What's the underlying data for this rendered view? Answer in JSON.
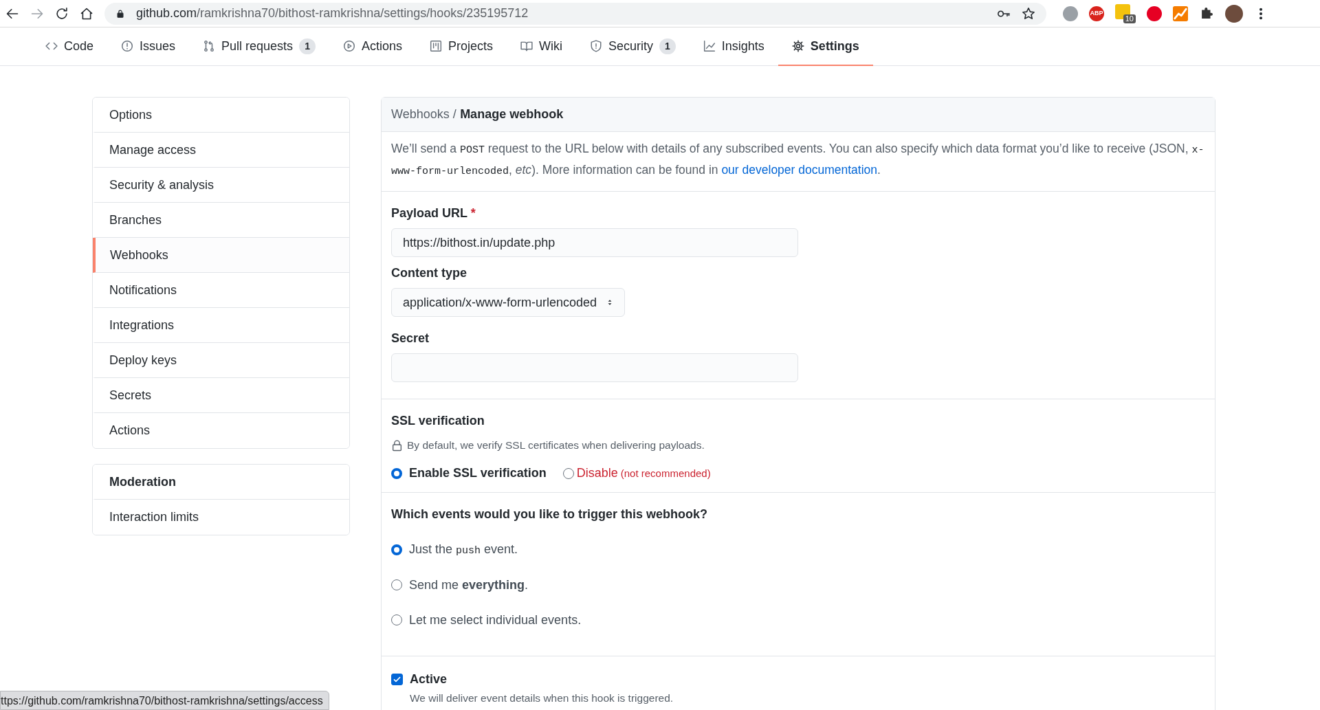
{
  "browser": {
    "host": "github.com",
    "path": "/ramkrishna70/bithost-ramkrishna/settings/hooks/235195712",
    "extensions": [
      {
        "kind": "skype"
      },
      {
        "kind": "abp",
        "text": "ABP"
      },
      {
        "kind": "notes",
        "badge": "10"
      },
      {
        "kind": "pinterest"
      },
      {
        "kind": "chart"
      },
      {
        "kind": "puzzle"
      },
      {
        "kind": "avatar"
      }
    ]
  },
  "repo_tabs": [
    {
      "label": "Code",
      "selected": false
    },
    {
      "label": "Issues",
      "selected": false
    },
    {
      "label": "Pull requests",
      "count": "1",
      "selected": false
    },
    {
      "label": "Actions",
      "selected": false
    },
    {
      "label": "Projects",
      "selected": false
    },
    {
      "label": "Wiki",
      "selected": false
    },
    {
      "label": "Security",
      "count": "1",
      "selected": false
    },
    {
      "label": "Insights",
      "selected": false
    },
    {
      "label": "Settings",
      "selected": true
    }
  ],
  "sidebar": [
    {
      "items": [
        {
          "label": "Options",
          "selected": false
        },
        {
          "label": "Manage access",
          "selected": false
        },
        {
          "label": "Security & analysis",
          "selected": false
        },
        {
          "label": "Branches",
          "selected": false
        },
        {
          "label": "Webhooks",
          "selected": true
        },
        {
          "label": "Notifications",
          "selected": false
        },
        {
          "label": "Integrations",
          "selected": false
        },
        {
          "label": "Deploy keys",
          "selected": false
        },
        {
          "label": "Secrets",
          "selected": false
        },
        {
          "label": "Actions",
          "selected": false
        }
      ]
    },
    {
      "heading": "Moderation",
      "items": [
        {
          "label": "Interaction limits",
          "selected": false
        }
      ]
    }
  ],
  "breadcrumb": {
    "parent": "Webhooks",
    "separator": "/",
    "current": "Manage webhook"
  },
  "intro": [
    {
      "kind": "text",
      "text": "We’ll send a "
    },
    {
      "kind": "code",
      "text": "POST"
    },
    {
      "kind": "text",
      "text": " request to the URL below with details of any subscribed events. You can also specify which data format you’d like to receive (JSON, "
    },
    {
      "kind": "code",
      "text": "x-www-form-urlencoded"
    },
    {
      "kind": "text",
      "text": ", "
    },
    {
      "kind": "italic",
      "text": "etc"
    },
    {
      "kind": "text",
      "text": "). More information can be found in "
    },
    {
      "kind": "link",
      "text": "our developer documentation"
    },
    {
      "kind": "text",
      "text": "."
    }
  ],
  "fields": [
    {
      "kind": "text",
      "label": "Payload URL",
      "required_mark": "*",
      "value": "https://bithost.in/update.php"
    },
    {
      "kind": "select",
      "label": "Content type",
      "value": "application/x-www-form-urlencoded"
    },
    {
      "kind": "text",
      "label": "Secret"
    }
  ],
  "ssl": {
    "heading": "SSL verification",
    "note": "By default, we verify SSL certificates when delivering payloads.",
    "options": [
      {
        "label": "Enable SSL verification",
        "danger": false,
        "selected": true
      },
      {
        "label": "Disable",
        "note": "(not recommended)",
        "danger": true,
        "selected": false
      }
    ]
  },
  "events": {
    "question": "Which events would you like to trigger this webhook?",
    "options": [
      {
        "selected": true,
        "parts": [
          {
            "kind": "text",
            "text": "Just the "
          },
          {
            "kind": "code",
            "text": "push"
          },
          {
            "kind": "text",
            "text": " event."
          }
        ]
      },
      {
        "selected": false,
        "parts": [
          {
            "kind": "text",
            "text": "Send me "
          },
          {
            "kind": "bold",
            "text": "everything"
          },
          {
            "kind": "text",
            "text": "."
          }
        ]
      },
      {
        "selected": false,
        "parts": [
          {
            "kind": "text",
            "text": "Let me select individual events."
          }
        ]
      }
    ]
  },
  "active": {
    "label": "Active",
    "checked": true,
    "description": "We will deliver event details when this hook is triggered."
  },
  "status_bar": {
    "url": "ttps://github.com/ramkrishna70/bithost-ramkrishna/settings/access"
  }
}
